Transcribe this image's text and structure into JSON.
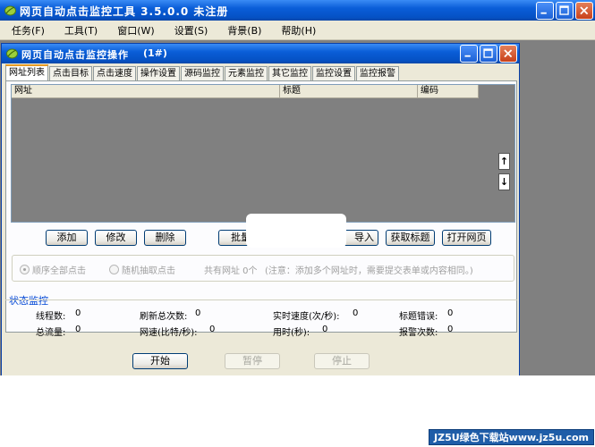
{
  "main_window": {
    "title": "网页自动点击监控工具  3.5.0.0  未注册"
  },
  "menu": [
    "任务(F)",
    "工具(T)",
    "窗口(W)",
    "设置(S)",
    "背景(B)",
    "帮助(H)"
  ],
  "child_window": {
    "title": "网页自动点击监控操作",
    "suffix": "(1#)"
  },
  "tabs": [
    "网址列表",
    "点击目标",
    "点击速度",
    "操作设置",
    "源码监控",
    "元素监控",
    "其它监控",
    "监控设置",
    "监控报警"
  ],
  "list_columns": [
    "网址",
    "标题",
    "编码"
  ],
  "scroll_up": "↑",
  "scroll_down": "↓",
  "list_buttons": {
    "add": "添加",
    "edit": "修改",
    "delete": "删除",
    "batch": "批量",
    "import": "导入",
    "fetch_title": "获取标题",
    "open_page": "打开网页"
  },
  "options": {
    "sequential": "顺序全部点击",
    "random": "随机抽取点击",
    "count_text": "共有网址  0个",
    "note": "(注意：添加多个网址时，需要提交表单或内容相同。)"
  },
  "status": {
    "title": "状态监控",
    "threads_label": "线程数:",
    "threads_value": "0",
    "refresh_label": "刷新总次数:",
    "refresh_value": "0",
    "speed_label": "实时速度(次/秒):",
    "speed_value": "0",
    "title_err_label": "标题错误:",
    "title_err_value": "0",
    "traffic_label": "总流量:",
    "traffic_value": "0",
    "netspeed_label": "网速(比特/秒):",
    "netspeed_value": "0",
    "time_label": "用时(秒):",
    "time_value": "0",
    "alarm_label": "报警次数:",
    "alarm_value": "0"
  },
  "controls": {
    "start": "开始",
    "pause": "暂停",
    "stop": "停止"
  },
  "watermark": "JZ5U绿色下载站www.jz5u.com"
}
